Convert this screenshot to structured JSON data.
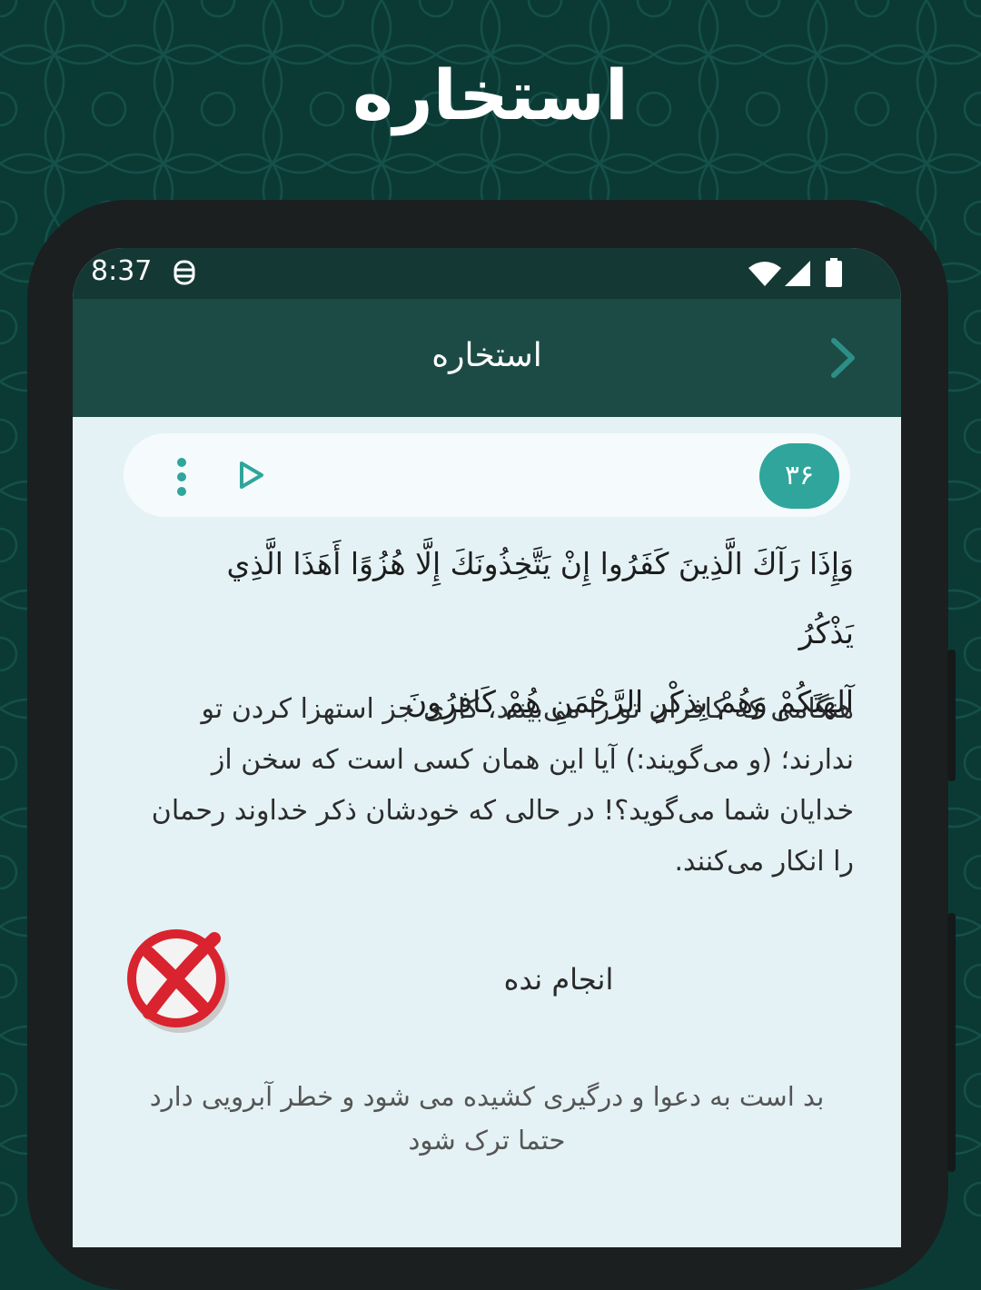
{
  "promo": {
    "title": "استخاره"
  },
  "status_bar": {
    "time": "8:37"
  },
  "app_bar": {
    "title": "استخاره"
  },
  "verse": {
    "number": "۳۶",
    "arabic_line1": "وَإِذَا رَآكَ الَّذِينَ كَفَرُوا إِنْ يَتَّخِذُونَكَ إِلَّا هُزُوًا أَهَذَا الَّذِي يَذْكُرُ",
    "arabic_line2": "آلِهَتَكُمْ وَهُمْ بِذِكْرِ الرَّحْمَنِ هُمْ كَافِرُونَ",
    "translation": "هنگامی که کافران تو را می‌بینند، کاری جز استهزا کردن تو ندارند؛ (و می‌گویند:) آیا این همان کسی است که سخن از خدایان شما می‌گوید؟! در حالی که خودشان ذکر خداوند رحمان را انکار می‌کنند."
  },
  "result": {
    "label": "انجام نده",
    "description": "بد است به دعوا و درگیری کشیده می شود و خطر آبرویی دارد حتما ترک شود"
  },
  "colors": {
    "background": "#0b3a35",
    "app_bar": "#1b4b44",
    "accent": "#2fa59c",
    "screen": "#e4f2f5",
    "reject": "#d9232e"
  },
  "icons": {
    "back": "chevron-right-icon",
    "play": "play-icon",
    "more": "more-vertical-icon",
    "result": "reject-x-icon",
    "notification": "notification-icon",
    "wifi": "wifi-icon",
    "signal": "signal-icon",
    "battery": "battery-icon"
  }
}
